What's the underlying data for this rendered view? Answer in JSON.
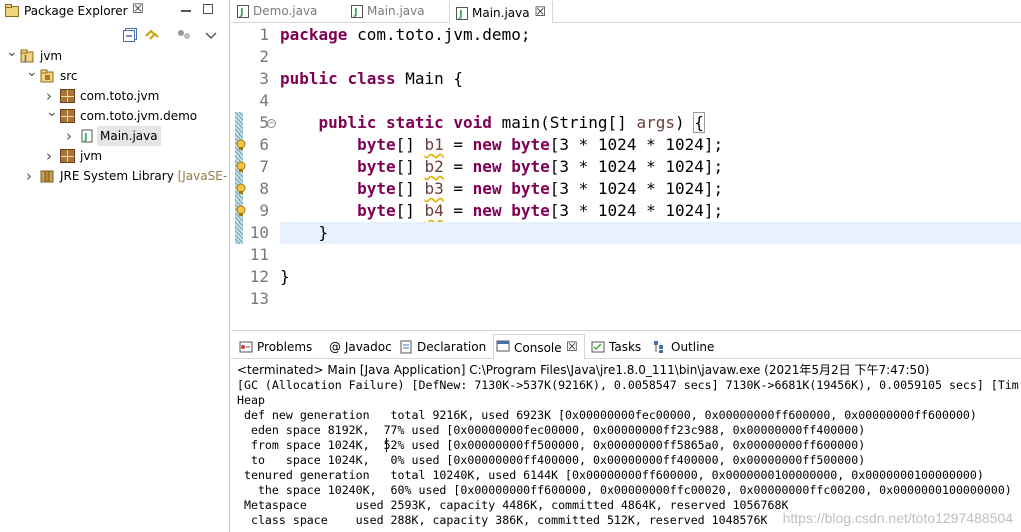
{
  "explorer": {
    "title": "Package Explorer",
    "close_glyph": "☒",
    "tree": [
      {
        "label": "jvm",
        "suffix": "",
        "depth": 0,
        "expanded": true,
        "kind": "project"
      },
      {
        "label": "src",
        "suffix": "",
        "depth": 1,
        "expanded": true,
        "kind": "folder"
      },
      {
        "label": "com.toto.jvm",
        "suffix": "",
        "depth": 2,
        "expanded": false,
        "kind": "package"
      },
      {
        "label": "com.toto.jvm.demo",
        "suffix": "",
        "depth": 2,
        "expanded": true,
        "kind": "package"
      },
      {
        "label": "Main.java",
        "suffix": "",
        "depth": 3,
        "expanded": false,
        "kind": "file",
        "selected": true
      },
      {
        "label": "jvm",
        "suffix": "",
        "depth": 2,
        "expanded": false,
        "kind": "package"
      },
      {
        "label": "JRE System Library ",
        "suffix": "[JavaSE-",
        "depth": 1,
        "expanded": false,
        "kind": "library"
      }
    ]
  },
  "editor": {
    "tabs": [
      {
        "label": "Demo.java",
        "active": false
      },
      {
        "label": "Main.java",
        "active": false
      },
      {
        "label": "Main.java",
        "active": true
      }
    ],
    "close_glyph": "☒",
    "line_numbers": [
      "1",
      "2",
      "3",
      "4",
      "5",
      "6",
      "7",
      "8",
      "9",
      "10",
      "11",
      "12",
      "13"
    ],
    "code": {
      "l1": {
        "kw": "package",
        "rest": " com.toto.jvm.demo;"
      },
      "l3": {
        "kw1": "public",
        "kw2": "class",
        "rest": " Main {"
      },
      "l5": {
        "indent": "    ",
        "kw1": "public",
        "kw2": "static",
        "kw3": "void",
        "name": " main(String[] ",
        "param": "args",
        "close": ") ",
        "brace": "{"
      },
      "decls": [
        {
          "indent": "        ",
          "type": "byte",
          "brk": "[] ",
          "var": "b1",
          "eq": " = ",
          "new": "new",
          "sp": " ",
          "type2": "byte",
          "tail": "[3 * 1024 * 1024];"
        },
        {
          "indent": "        ",
          "type": "byte",
          "brk": "[] ",
          "var": "b2",
          "eq": " = ",
          "new": "new",
          "sp": " ",
          "type2": "byte",
          "tail": "[3 * 1024 * 1024];"
        },
        {
          "indent": "        ",
          "type": "byte",
          "brk": "[] ",
          "var": "b3",
          "eq": " = ",
          "new": "new",
          "sp": " ",
          "type2": "byte",
          "tail": "[3 * 1024 * 1024];"
        },
        {
          "indent": "        ",
          "type": "byte",
          "brk": "[] ",
          "var": "b4",
          "eq": " = ",
          "new": "new",
          "sp": " ",
          "type2": "byte",
          "tail": "[3 * 1024 * 1024];"
        }
      ],
      "l10": "    }",
      "l12": "}"
    }
  },
  "bottom": {
    "tabs": [
      {
        "label": "Problems",
        "icon": "problems-icon"
      },
      {
        "label": "@ Javadoc",
        "icon": "javadoc-icon"
      },
      {
        "label": "Declaration",
        "icon": "declaration-icon"
      },
      {
        "label": "Console",
        "icon": "console-icon",
        "active": true
      },
      {
        "label": "Tasks",
        "icon": "tasks-icon"
      },
      {
        "label": "Outline",
        "icon": "outline-icon"
      }
    ],
    "close_glyph": "☒",
    "console_header": "<terminated> Main [Java Application] C:\\Program Files\\Java\\jre1.8.0_111\\bin\\javaw.exe (2021年5月2日 下午7:47:50)",
    "output": [
      "[GC (Allocation Failure) [DefNew: 7130K->537K(9216K), 0.0058547 secs] 7130K->6681K(19456K), 0.0059105 secs] [Tim",
      "Heap",
      " def new generation   total 9216K, used 6923K [0x00000000fec00000, 0x00000000ff600000, 0x00000000ff600000)",
      "  eden space 8192K,  77% used [0x00000000fec00000, 0x00000000ff23c988, 0x00000000ff400000)",
      "  from space 1024K,  52% used [0x00000000ff500000, 0x00000000ff5865a0, 0x00000000ff600000)",
      "  to   space 1024K,   0% used [0x00000000ff400000, 0x00000000ff400000, 0x00000000ff500000)",
      " tenured generation   total 10240K, used 6144K [0x00000000ff600000, 0x0000000100000000, 0x0000000100000000)",
      "   the space 10240K,  60% used [0x00000000ff600000, 0x00000000ffc00020, 0x00000000ffc00200, 0x0000000100000000)",
      " Metaspace       used 2593K, capacity 4486K, committed 4864K, reserved 1056768K",
      "  class space    used 288K, capacity 386K, committed 512K, reserved 1048576K"
    ],
    "watermark": "https://blog.csdn.net/toto1297488504"
  }
}
